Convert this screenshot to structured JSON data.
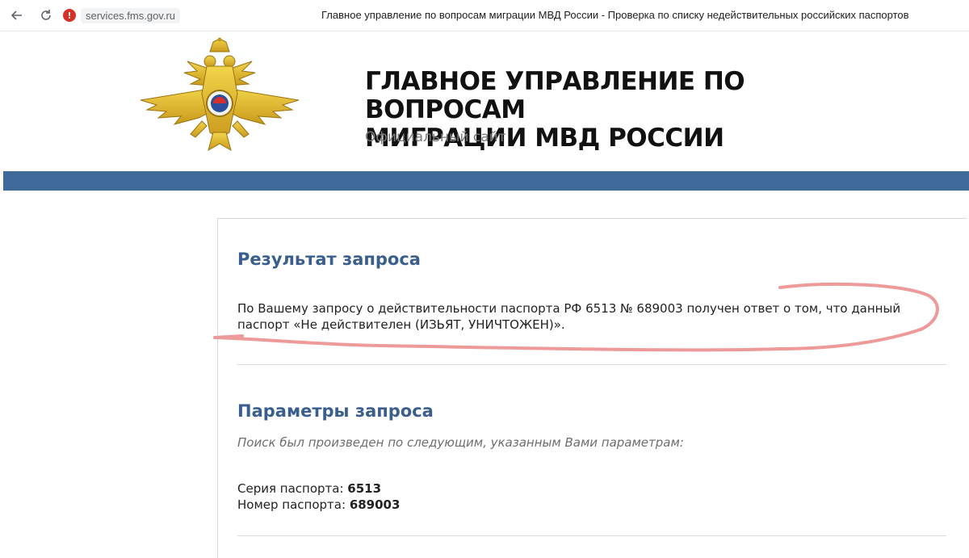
{
  "browser": {
    "url": "services.fms.gov.ru",
    "tab_title": "Главное управление по вопросам миграции МВД России - Проверка по списку недействительных российских паспортов",
    "back_icon": "arrow-left",
    "reload_icon": "reload",
    "warning_icon": "not-secure-warning"
  },
  "header": {
    "title_line1": "ГЛАВНОЕ УПРАВЛЕНИЕ ПО ВОПРОСАМ",
    "title_line2": "МИГРАЦИИ МВД РОССИИ",
    "subtitle": "Официальный сайт",
    "bar_color": "#3f6a9a"
  },
  "result": {
    "heading": "Результат запроса",
    "text": "По Вашему запросу о действительности паспорта РФ 6513 № 689003 получен ответ о том, что данный паспорт «Не действителен (ИЗЬЯТ, УНИЧТОЖЕН)»."
  },
  "params": {
    "heading": "Параметры запроса",
    "note": "Поиск был произведен по следующим, указанным Вами параметрам:",
    "series_label": "Серия паспорта:",
    "series_value": "6513",
    "number_label": "Номер паспорта:",
    "number_value": "689003"
  },
  "colors": {
    "heading": "#3a5f8f",
    "annotation": "#ee9a9a"
  }
}
